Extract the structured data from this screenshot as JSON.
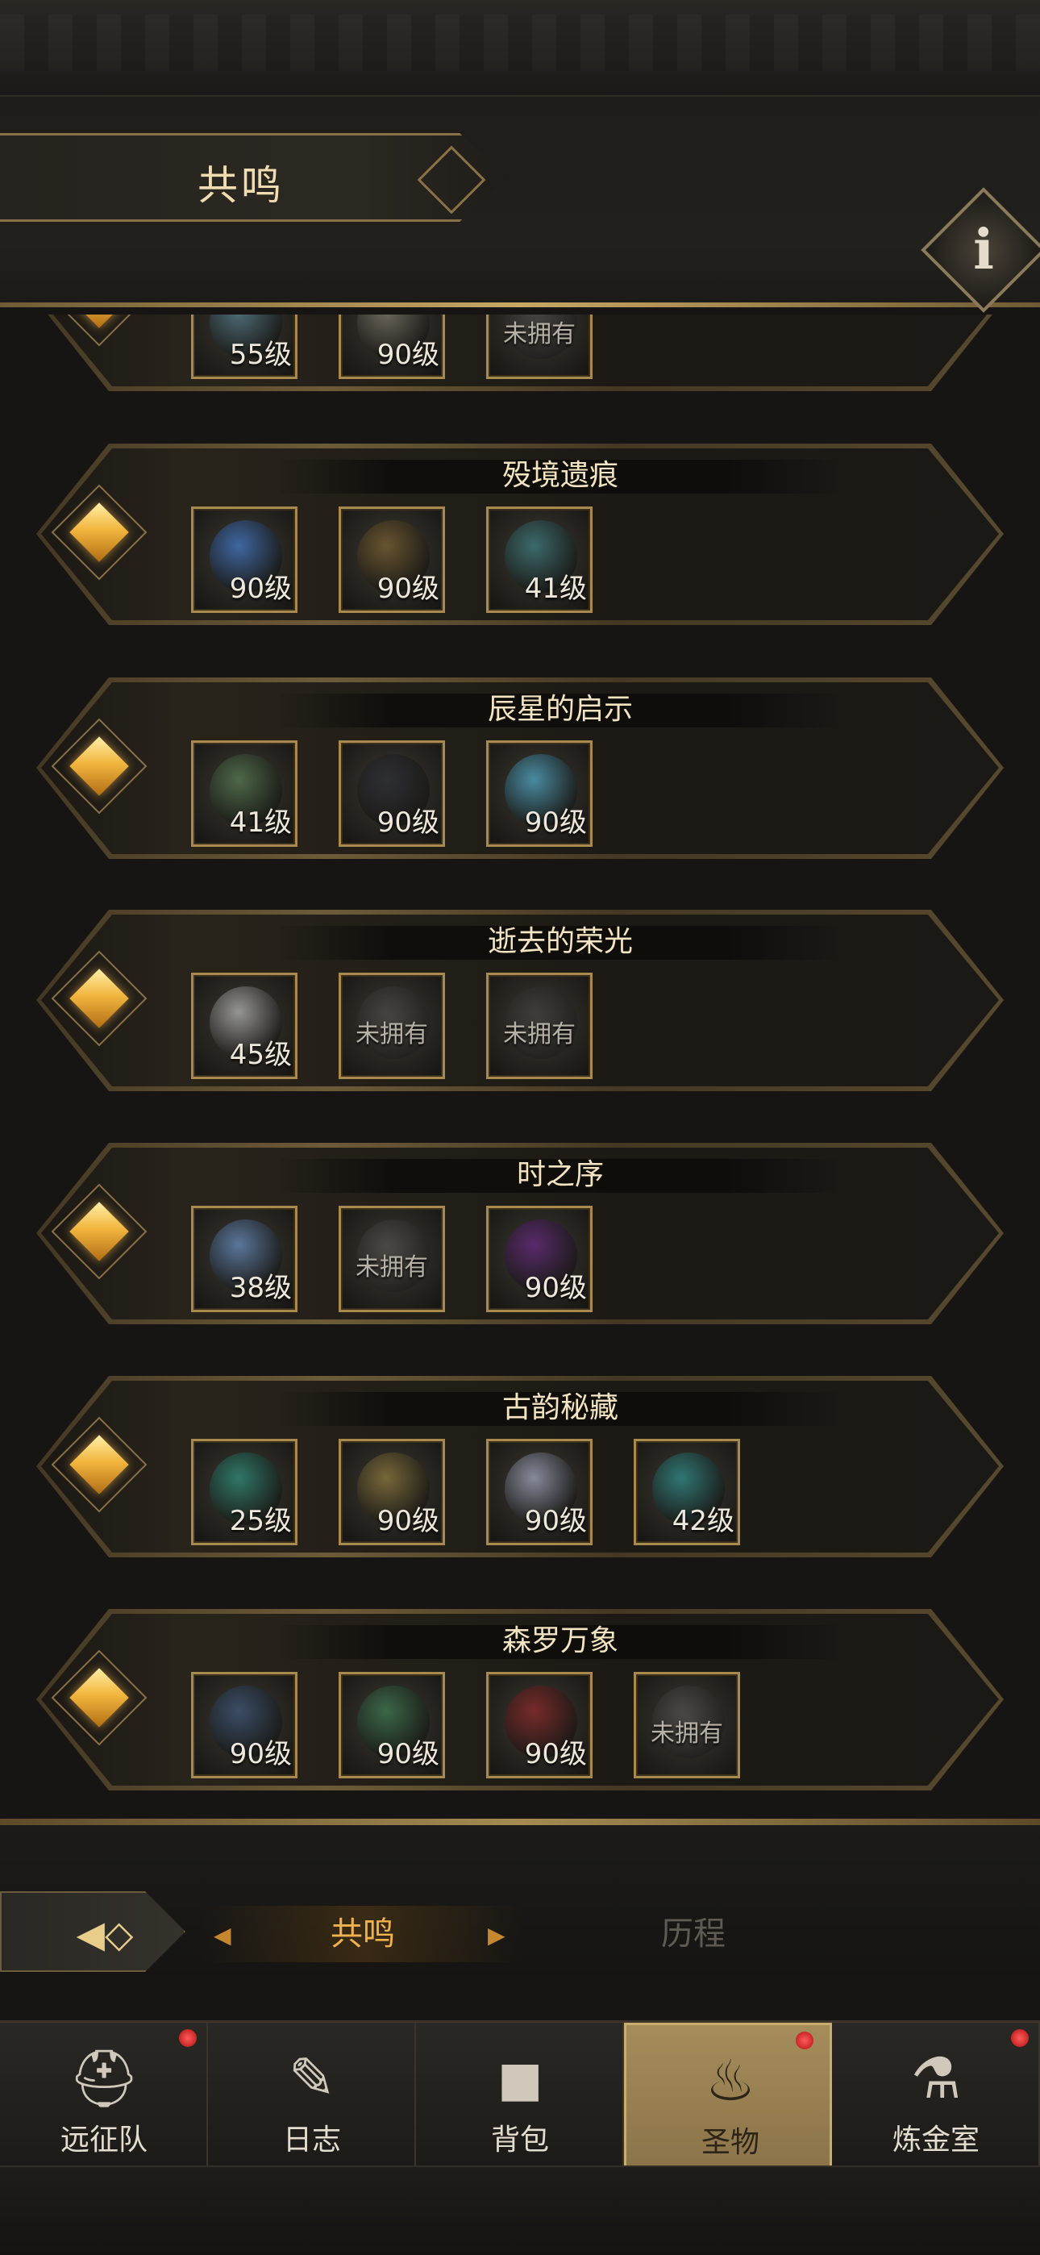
{
  "header": {
    "title": "共鸣",
    "info_icon": "info-icon"
  },
  "sets": [
    {
      "title": "",
      "items": [
        {
          "level": "55级",
          "owned": true,
          "color": "#4e6f7a"
        },
        {
          "level": "90级",
          "owned": true,
          "color": "#6f6a5e"
        },
        {
          "level": "未拥有",
          "owned": false,
          "color": "#5a5a5a"
        }
      ]
    },
    {
      "title": "殁境遗痕",
      "items": [
        {
          "level": "90级",
          "owned": true,
          "color": "#3f6aa8"
        },
        {
          "level": "90级",
          "owned": true,
          "color": "#6b5630"
        },
        {
          "level": "41级",
          "owned": true,
          "color": "#3c6d6e"
        }
      ]
    },
    {
      "title": "辰星的启示",
      "items": [
        {
          "level": "41级",
          "owned": true,
          "color": "#4f6b4a"
        },
        {
          "level": "90级",
          "owned": true,
          "color": "#2e2f35"
        },
        {
          "level": "90级",
          "owned": true,
          "color": "#4a8fa6"
        }
      ]
    },
    {
      "title": "逝去的荣光",
      "items": [
        {
          "level": "45级",
          "owned": true,
          "color": "#9a9a9a"
        },
        {
          "level": "未拥有",
          "owned": false,
          "color": "#5e5e5e"
        },
        {
          "level": "未拥有",
          "owned": false,
          "color": "#4a4a4a"
        }
      ]
    },
    {
      "title": "时之序",
      "items": [
        {
          "level": "38级",
          "owned": true,
          "color": "#5b7aa0"
        },
        {
          "level": "未拥有",
          "owned": false,
          "color": "#6c6c6c"
        },
        {
          "level": "90级",
          "owned": true,
          "color": "#5a2a6e"
        }
      ]
    },
    {
      "title": "古韵秘藏",
      "items": [
        {
          "level": "25级",
          "owned": true,
          "color": "#2f7a6a"
        },
        {
          "level": "90级",
          "owned": true,
          "color": "#7a6a3a"
        },
        {
          "level": "90级",
          "owned": true,
          "color": "#8a8ea0"
        },
        {
          "level": "42级",
          "owned": true,
          "color": "#2f7a78"
        }
      ]
    },
    {
      "title": "森罗万象",
      "items": [
        {
          "level": "90级",
          "owned": true,
          "color": "#3a4f6a"
        },
        {
          "level": "90级",
          "owned": true,
          "color": "#3b6a4a"
        },
        {
          "level": "90级",
          "owned": true,
          "color": "#7a2a2a"
        },
        {
          "level": "未拥有",
          "owned": false,
          "color": "#6a6a6a"
        }
      ]
    }
  ],
  "subtabs": {
    "active": "共鸣",
    "inactive": "历程",
    "back_icon": "back-arrow-icon"
  },
  "nav": [
    {
      "label": "远征队",
      "icon": "helmet-icon",
      "glyph": "⛑",
      "badge": true
    },
    {
      "label": "日志",
      "icon": "journal-icon",
      "glyph": "✎",
      "badge": false
    },
    {
      "label": "背包",
      "icon": "backpack-icon",
      "glyph": "◼",
      "badge": false
    },
    {
      "label": "圣物",
      "icon": "brazier-icon",
      "glyph": "♨",
      "badge": true,
      "active": true
    },
    {
      "label": "炼金室",
      "icon": "alchemy-icon",
      "glyph": "⚗",
      "badge": true
    }
  ]
}
